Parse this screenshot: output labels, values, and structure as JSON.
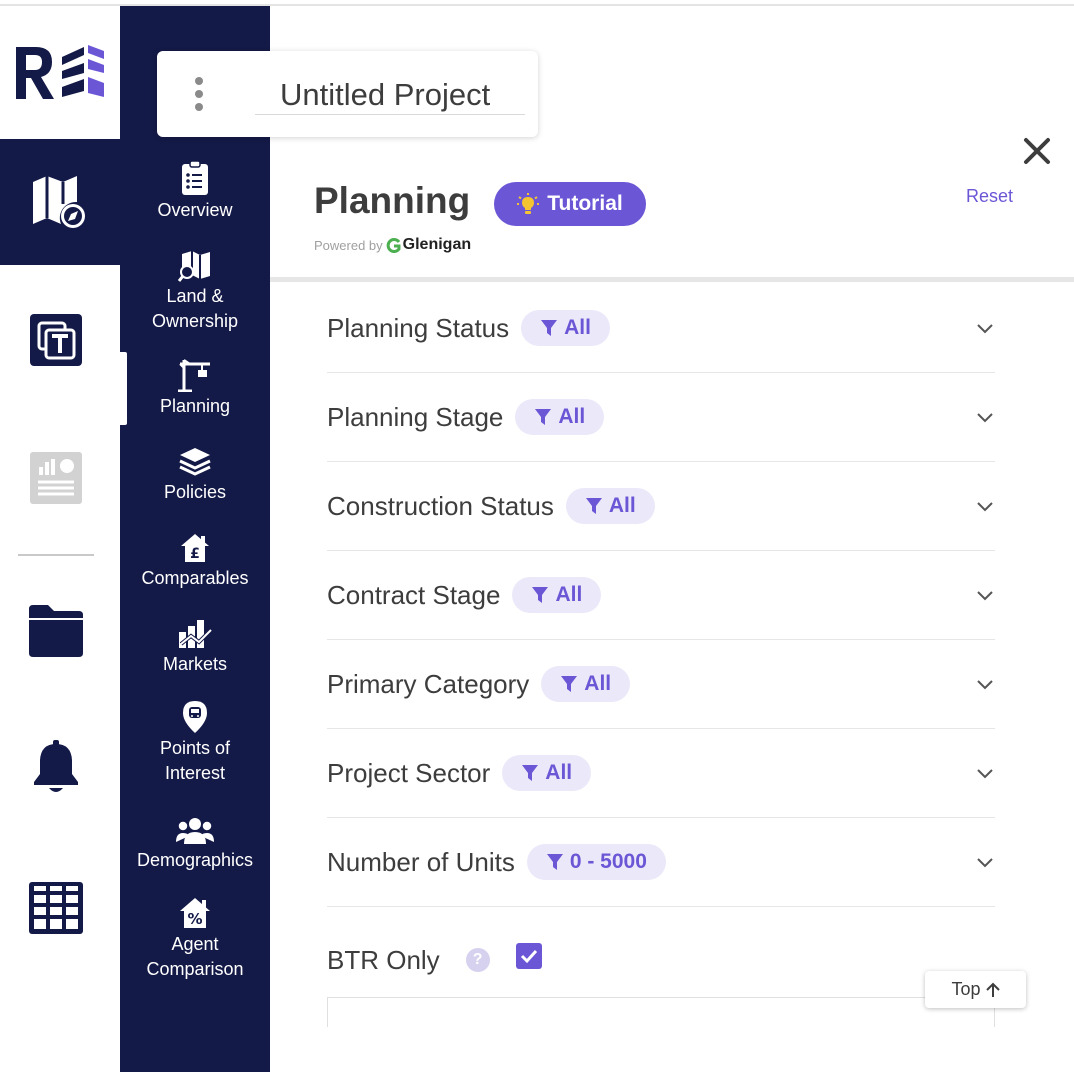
{
  "project": {
    "title": "Untitled Project"
  },
  "menu": {
    "items": [
      {
        "label": "Overview"
      },
      {
        "label": "Land &\nOwnership"
      },
      {
        "label": "Planning"
      },
      {
        "label": "Policies"
      },
      {
        "label": "Comparables"
      },
      {
        "label": "Markets"
      },
      {
        "label": "Points of\nInterest"
      },
      {
        "label": "Demographics"
      },
      {
        "label": "Agent\nComparison"
      }
    ],
    "active": "Planning"
  },
  "panel": {
    "title": "Planning",
    "tutorial_label": "Tutorial",
    "powered_by": "Powered by",
    "brand": "Glenigan",
    "reset_label": "Reset"
  },
  "filters": [
    {
      "label": "Planning Status",
      "value": "All"
    },
    {
      "label": "Planning Stage",
      "value": "All"
    },
    {
      "label": "Construction Status",
      "value": "All"
    },
    {
      "label": "Contract Stage",
      "value": "All"
    },
    {
      "label": "Primary Category",
      "value": "All"
    },
    {
      "label": "Project Sector",
      "value": "All"
    },
    {
      "label": "Number of Units",
      "value": "0 - 5000"
    }
  ],
  "btr": {
    "label": "BTR Only",
    "help": "?",
    "checked": true
  },
  "top_button": {
    "label": "Top"
  },
  "colors": {
    "navy": "#141a47",
    "accent": "#6b57d6",
    "chip_bg": "#ebe8f9"
  }
}
